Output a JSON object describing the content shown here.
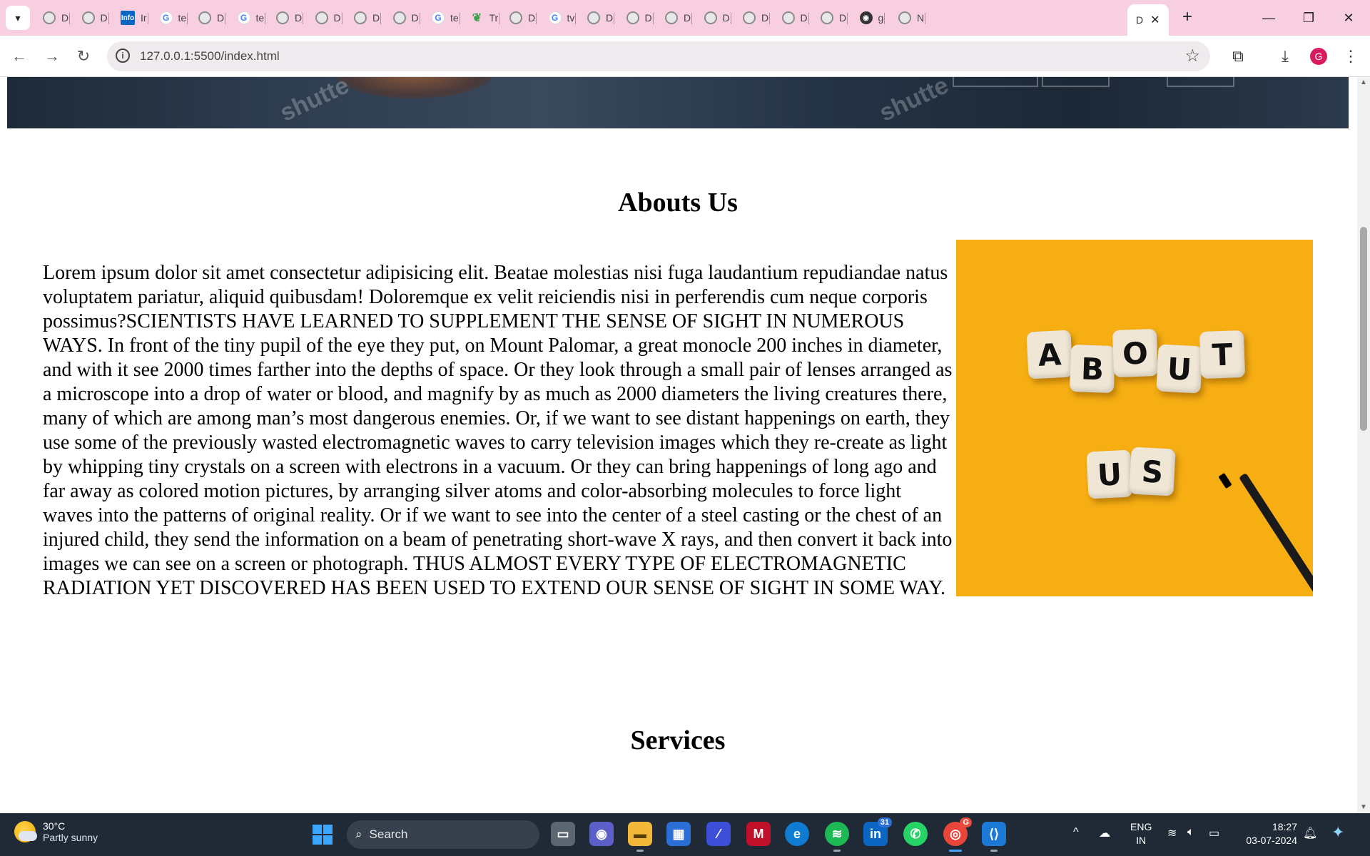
{
  "browser": {
    "tabs": [
      {
        "favicon": "globe-icon",
        "label": "D"
      },
      {
        "favicon": "globe-icon",
        "label": "D"
      },
      {
        "favicon": "info-icon",
        "label": "Ir"
      },
      {
        "favicon": "google-icon",
        "label": "te"
      },
      {
        "favicon": "globe-icon",
        "label": "D"
      },
      {
        "favicon": "google-icon",
        "label": "te"
      },
      {
        "favicon": "globe-icon",
        "label": "D"
      },
      {
        "favicon": "globe-icon",
        "label": "D"
      },
      {
        "favicon": "globe-icon",
        "label": "D"
      },
      {
        "favicon": "globe-icon",
        "label": "D"
      },
      {
        "favicon": "google-icon",
        "label": "te"
      },
      {
        "favicon": "leaf-icon",
        "label": "Tr"
      },
      {
        "favicon": "globe-icon",
        "label": "D"
      },
      {
        "favicon": "google-icon",
        "label": "tv"
      },
      {
        "favicon": "globe-icon",
        "label": "D"
      },
      {
        "favicon": "globe-icon",
        "label": "D"
      },
      {
        "favicon": "globe-icon",
        "label": "D"
      },
      {
        "favicon": "globe-icon",
        "label": "D"
      },
      {
        "favicon": "globe-icon",
        "label": "D"
      },
      {
        "favicon": "globe-icon",
        "label": "D"
      },
      {
        "favicon": "globe-icon",
        "label": "D"
      },
      {
        "favicon": "github-icon",
        "label": "g"
      },
      {
        "favicon": "globe-icon",
        "label": "N"
      }
    ],
    "active_tab": {
      "label": "D",
      "close": "✕"
    },
    "new_tab": "+",
    "url": "127.0.0.1:5500/index.html"
  },
  "page": {
    "about_title": "Abouts Us",
    "about_text": "Lorem ipsum dolor sit amet consectetur adipisicing elit. Beatae molestias nisi fuga laudantium repudiandae natus voluptatem pariatur, aliquid quibusdam! Doloremque ex velit reiciendis nisi in perferendis cum neque corporis possimus?SCIENTISTS HAVE LEARNED TO SUPPLEMENT THE SENSE OF SIGHT IN NUMEROUS WAYS. In front of the tiny pupil of the eye they put, on Mount Palomar, a great monocle 200 inches in diameter, and with it see 2000 times farther into the depths of space. Or they look through a small pair of lenses arranged as a microscope into a drop of water or blood, and magnify by as much as 2000 diameters the living creatures there, many of which are among man’s most dangerous enemies. Or, if we want to see distant happenings on earth, they use some of the previously wasted electromagnetic waves to carry television images which they re-create as light by whipping tiny crystals on a screen with electrons in a vacuum. Or they can bring happenings of long ago and far away as colored motion pictures, by arranging silver atoms and color-absorbing molecules to force light waves into the patterns of original reality. Or if we want to see into the center of a steel casting or the chest of an injured child, they send the information on a beam of penetrating short-wave X rays, and then convert it back into images we can see on a screen or photograph. THUS ALMOST EVERY TYPE OF ELECTROMAGNETIC RADIATION YET DISCOVERED HAS BEEN USED TO EXTEND OUR SENSE OF SIGHT IN SOME WAY.",
    "about_image_letters_top": [
      "A",
      "B",
      "O",
      "U",
      "T"
    ],
    "about_image_letters_bottom": [
      "U",
      "S"
    ],
    "hero_watermark": "shutte",
    "services_title": "Services"
  },
  "taskbar": {
    "weather_temp": "30°C",
    "weather_desc": "Partly sunny",
    "search_label": "Search",
    "linkedin_badge": "31",
    "chrome_badge": "G",
    "lang_line1": "ENG",
    "lang_line2": "IN",
    "time": "18:27",
    "date": "03-07-2024"
  },
  "colors": {
    "tabstrip_bg": "#f7cfe0",
    "about_image_bg": "#f6ae13",
    "taskbar_bg": "#1f2a36"
  }
}
